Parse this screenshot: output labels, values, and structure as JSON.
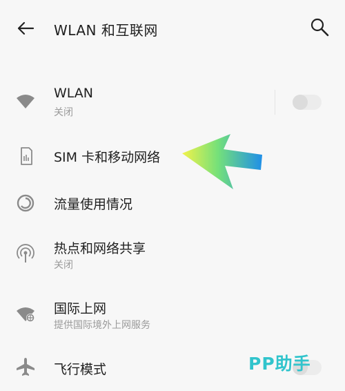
{
  "header": {
    "title": "WLAN 和互联网"
  },
  "rows": {
    "wlan": {
      "label": "WLAN",
      "sub": "关闭",
      "toggle_on": false
    },
    "sim": {
      "label": "SIM 卡和移动网络"
    },
    "data_usage": {
      "label": "流量使用情况"
    },
    "hotspot": {
      "label": "热点和网络共享",
      "sub": "关闭"
    },
    "intl": {
      "label": "国际上网",
      "sub": "提供国际境外上网服务"
    },
    "airplane": {
      "label": "飞行模式",
      "toggle_on": false
    }
  },
  "watermark": "PP助手",
  "colors": {
    "icon": "#8a8a8a",
    "sub_text": "#9a9a9a",
    "watermark": "#31c4cc"
  }
}
